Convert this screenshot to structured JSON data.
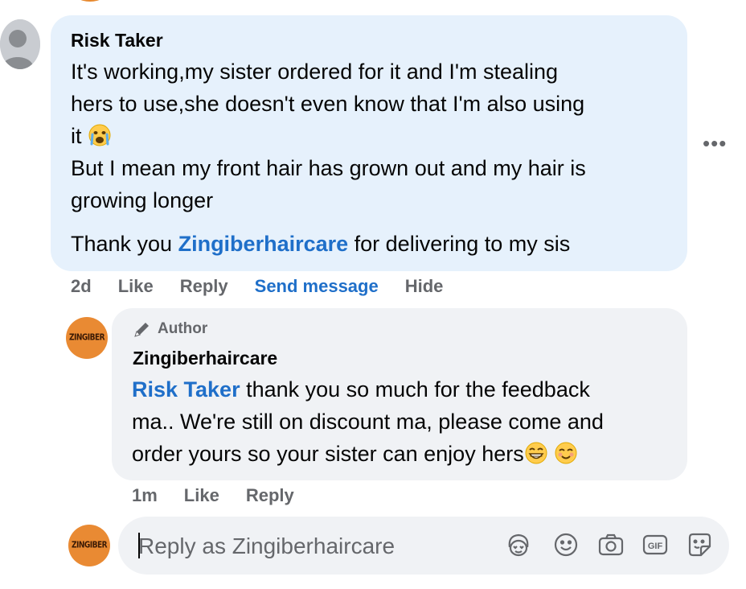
{
  "comment": {
    "author": "Risk Taker",
    "lines": [
      "It's working,my sister ordered for it and I'm stealing",
      "hers to use,she doesn't even know that I'm also using",
      "it"
    ],
    "line4": "But I mean my front hair has grown out and my hair is",
    "line5": "growing longer",
    "thanks_prefix": "Thank you ",
    "thanks_link": "Zingiberhaircare",
    "thanks_suffix": " for delivering to my sis",
    "time": "2d",
    "actions": {
      "like": "Like",
      "reply": "Reply",
      "send_message": "Send message",
      "hide": "Hide"
    },
    "more": "•••",
    "emoji": "crying-face-icon"
  },
  "reply": {
    "badge": "Author",
    "author": "Zingiberhaircare",
    "mention": "Risk Taker",
    "line1_rest": " thank you so much for the feedback",
    "line2": "ma.. We're still on discount ma, please come and",
    "line3": "order yours so your sister can enjoy hers",
    "emojis": [
      "grinning-face-icon",
      "smiling-face-icon"
    ],
    "time": "1m",
    "actions": {
      "like": "Like",
      "reply": "Reply"
    },
    "avatar_text": "ZINGIBER"
  },
  "composer": {
    "placeholder": "Reply as Zingiberhaircare",
    "tools": [
      "avatar-sticker-icon",
      "emoji-icon",
      "camera-icon",
      "gif-icon",
      "sticker-icon"
    ],
    "gif_label": "GIF"
  },
  "colors": {
    "link": "#1f6fc9",
    "bubble_commenter": "#e6f1fc",
    "bubble_reply": "#f0f2f5",
    "muted": "#65676b",
    "avatar_orange": "#e98a33"
  }
}
